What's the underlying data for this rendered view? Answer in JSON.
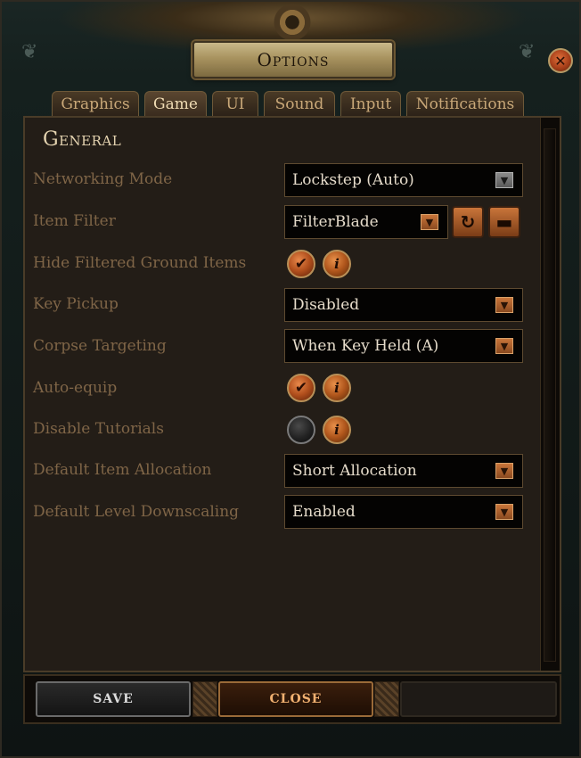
{
  "window": {
    "title": "Options",
    "close_symbol": "✕"
  },
  "tabs": [
    {
      "label": "Graphics",
      "active": false
    },
    {
      "label": "Game",
      "active": true
    },
    {
      "label": "UI",
      "active": false
    },
    {
      "label": "Sound",
      "active": false
    },
    {
      "label": "Input",
      "active": false
    },
    {
      "label": "Notifications",
      "active": false
    }
  ],
  "section": {
    "title": "General"
  },
  "settings": {
    "networking_mode": {
      "label": "Networking Mode",
      "value": "Lockstep (Auto)"
    },
    "item_filter": {
      "label": "Item Filter",
      "value": "FilterBlade",
      "refresh_icon": "refresh-icon",
      "folder_icon": "folder-icon"
    },
    "hide_filtered_ground_items": {
      "label": "Hide Filtered Ground Items",
      "checked": true
    },
    "key_pickup": {
      "label": "Key Pickup",
      "value": "Disabled"
    },
    "corpse_targeting": {
      "label": "Corpse Targeting",
      "value": "When Key Held (A)"
    },
    "auto_equip": {
      "label": "Auto-equip",
      "checked": true
    },
    "disable_tutorials": {
      "label": "Disable Tutorials",
      "checked": false
    },
    "default_item_allocation": {
      "label": "Default Item Allocation",
      "value": "Short Allocation"
    },
    "default_level_downscaling": {
      "label": "Default Level Downscaling",
      "value": "Enabled"
    }
  },
  "glyphs": {
    "check": "✔",
    "info": "i",
    "arrow": "▼",
    "refresh": "↻",
    "folder": "▬"
  },
  "footer": {
    "save_label": "SAVE",
    "close_label": "CLOSE"
  },
  "colors": {
    "accent_orange": "#c9753a",
    "label_brown": "#7f6547",
    "title_gold": "#a8935f"
  }
}
